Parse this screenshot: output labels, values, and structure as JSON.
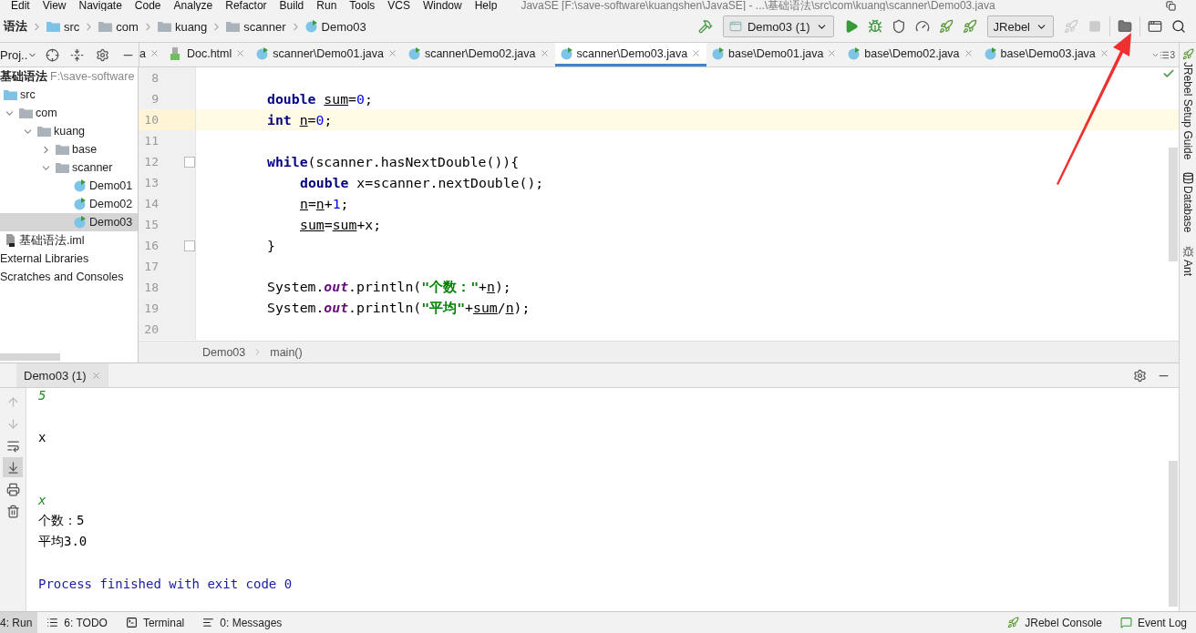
{
  "menu": {
    "items": [
      "Edit",
      "View",
      "Navigate",
      "Code",
      "Analyze",
      "Refactor",
      "Build",
      "Run",
      "Tools",
      "VCS",
      "Window",
      "Help"
    ],
    "title": "JavaSE [F:\\save-software\\kuangshen\\JavaSE] - ...\\基础语法\\src\\com\\kuang\\scanner\\Demo03.java"
  },
  "navbar": {
    "crumbs": [
      {
        "label": "语法",
        "kind": "project"
      },
      {
        "label": "src",
        "kind": "source"
      },
      {
        "label": "com",
        "kind": "folder"
      },
      {
        "label": "kuang",
        "kind": "folder"
      },
      {
        "label": "scanner",
        "kind": "folder"
      },
      {
        "label": "Demo03",
        "kind": "class"
      }
    ],
    "run_config": "Demo03 (1)",
    "jrebel_select": "JRebel"
  },
  "project_panel": {
    "title": "Proj..",
    "header": {
      "name": "基础语法",
      "path": "F:\\save-software"
    },
    "tree": [
      {
        "label": "src",
        "kind": "source",
        "selected": false
      },
      {
        "label": "com",
        "kind": "folder",
        "expanded": true,
        "selected": false,
        "children": [
          {
            "label": "kuang",
            "kind": "folder",
            "expanded": true,
            "selected": false,
            "children": [
              {
                "label": "base",
                "kind": "folder",
                "expanded": false,
                "selected": false
              },
              {
                "label": "scanner",
                "kind": "folder",
                "expanded": true,
                "selected": false,
                "children": [
                  {
                    "label": "Demo01",
                    "kind": "class",
                    "selected": false
                  },
                  {
                    "label": "Demo02",
                    "kind": "class",
                    "selected": false
                  },
                  {
                    "label": "Demo03",
                    "kind": "class",
                    "selected": true
                  }
                ]
              }
            ]
          }
        ]
      },
      {
        "label": "基础语法.iml",
        "kind": "file",
        "selected": false
      },
      {
        "label": "External Libraries",
        "kind": "plain",
        "selected": false
      },
      {
        "label": "Scratches and Consoles",
        "kind": "plain",
        "selected": false
      }
    ]
  },
  "editor_tabs": [
    {
      "label": "a",
      "kind": "cut",
      "selected": false
    },
    {
      "label": "Doc.html",
      "kind": "html",
      "selected": false
    },
    {
      "label": "scanner\\Demo01.java",
      "kind": "class",
      "selected": false
    },
    {
      "label": "scanner\\Demo02.java",
      "kind": "class",
      "selected": false
    },
    {
      "label": "scanner\\Demo03.java",
      "kind": "class",
      "selected": true
    },
    {
      "label": "base\\Demo01.java",
      "kind": "class",
      "selected": false
    },
    {
      "label": "base\\Demo02.java",
      "kind": "class",
      "selected": false
    },
    {
      "label": "base\\Demo03.java",
      "kind": "class",
      "selected": false
    }
  ],
  "tab_overflow": "3",
  "editor": {
    "lines": [
      {
        "number": "8",
        "highlighted": false,
        "fold": false
      },
      {
        "number": "9",
        "highlighted": false,
        "fold": false,
        "tokens": [
          {
            "text": "double",
            "kind": "type"
          },
          {
            "text": "sum",
            "kind": "var"
          },
          {
            "text": "=",
            "kind": "plain"
          },
          {
            "text": "0",
            "kind": "num"
          },
          {
            "text": ";",
            "kind": "plain"
          }
        ]
      },
      {
        "number": "10",
        "highlighted": true,
        "fold": false,
        "tokens": [
          {
            "text": "int",
            "kind": "type"
          },
          {
            "text": "n",
            "kind": "var"
          },
          {
            "text": "=",
            "kind": "plain"
          },
          {
            "text": "0",
            "kind": "num"
          },
          {
            "text": ";",
            "kind": "plain"
          }
        ]
      },
      {
        "number": "11",
        "highlighted": false,
        "fold": false
      },
      {
        "number": "12",
        "highlighted": false,
        "fold": true,
        "tokens": [
          {
            "text": "while",
            "kind": "kw"
          },
          {
            "text": "(scanner.hasNextDouble()){",
            "kind": "plain"
          }
        ],
        "children": [
          {
            "number": "13",
            "highlighted": false,
            "fold": false,
            "tokens": [
              {
                "text": "double",
                "kind": "type"
              },
              {
                "text": "x=scanner.nextDouble();",
                "kind": "plain"
              }
            ]
          },
          {
            "number": "14",
            "highlighted": false,
            "fold": false,
            "tokens": [
              {
                "text": "n",
                "kind": "var"
              },
              {
                "text": "=",
                "kind": "plain"
              },
              {
                "text": "n",
                "kind": "var"
              },
              {
                "text": "+",
                "kind": "plain"
              },
              {
                "text": "1",
                "kind": "num"
              },
              {
                "text": ";",
                "kind": "plain"
              }
            ]
          },
          {
            "number": "15",
            "highlighted": false,
            "fold": false,
            "tokens": [
              {
                "text": "sum",
                "kind": "var"
              },
              {
                "text": "=",
                "kind": "plain"
              },
              {
                "text": "sum",
                "kind": "var"
              },
              {
                "text": "+x;",
                "kind": "plain"
              }
            ]
          }
        ]
      },
      {
        "number": "16",
        "highlighted": false,
        "fold": true,
        "tokens": [
          {
            "text": "}",
            "kind": "plain"
          }
        ]
      },
      {
        "number": "17",
        "highlighted": false,
        "fold": false
      },
      {
        "number": "18",
        "highlighted": false,
        "fold": false,
        "tokens": [
          {
            "text": "System.",
            "kind": "plain"
          },
          {
            "text": "out",
            "kind": "field"
          },
          {
            "text": ".println(",
            "kind": "plain"
          },
          {
            "text": "\"个数：\"",
            "kind": "str"
          },
          {
            "text": "+",
            "kind": "plain"
          },
          {
            "text": "n",
            "kind": "var"
          },
          {
            "text": ");",
            "kind": "plain"
          }
        ]
      },
      {
        "number": "19",
        "highlighted": false,
        "fold": false,
        "tokens": [
          {
            "text": "System.",
            "kind": "plain"
          },
          {
            "text": "out",
            "kind": "field"
          },
          {
            "text": ".println(",
            "kind": "plain"
          },
          {
            "text": "\"平均\"",
            "kind": "str"
          },
          {
            "text": "+",
            "kind": "plain"
          },
          {
            "text": "sum",
            "kind": "var"
          },
          {
            "text": "/",
            "kind": "plain"
          },
          {
            "text": "n",
            "kind": "var"
          },
          {
            "text": ");",
            "kind": "plain"
          }
        ]
      },
      {
        "number": "20",
        "highlighted": false,
        "fold": false
      }
    ],
    "breadcrumb": [
      "Demo03",
      "main()"
    ]
  },
  "right_strip": [
    {
      "label": "JRebel Setup Guide",
      "kind": "rocket"
    },
    {
      "label": "Database",
      "kind": "database"
    },
    {
      "label": "Ant",
      "kind": "ant"
    }
  ],
  "run_panel": {
    "tab": "Demo03 (1)",
    "tools": [
      {
        "kind": "up",
        "selected": false,
        "disabled": true
      },
      {
        "kind": "down",
        "selected": false,
        "disabled": true
      },
      {
        "kind": "wrap",
        "selected": false,
        "disabled": false
      },
      {
        "kind": "scroll_end",
        "selected": true,
        "disabled": false
      },
      {
        "kind": "print",
        "selected": false,
        "disabled": false
      },
      {
        "kind": "trash",
        "selected": false,
        "disabled": false
      }
    ],
    "lines": [
      {
        "kind": "input",
        "text": "5"
      },
      {
        "kind": "blank"
      },
      {
        "kind": "output",
        "text": "x"
      },
      {
        "kind": "blank"
      },
      {
        "kind": "blank"
      },
      {
        "kind": "input",
        "text": "x"
      },
      {
        "kind": "output",
        "text": "个数：5"
      },
      {
        "kind": "output",
        "text": "平均3.0"
      },
      {
        "kind": "blank"
      },
      {
        "kind": "system",
        "text": "Process finished with exit code 0"
      }
    ]
  },
  "status_bar": {
    "left": [
      {
        "label": "4: Run",
        "kind": "none",
        "selected": true
      },
      {
        "label": "6: TODO",
        "kind": "list",
        "selected": false
      },
      {
        "label": "Terminal",
        "kind": "terminal",
        "selected": false
      },
      {
        "label": "0: Messages",
        "kind": "messages",
        "selected": false
      }
    ],
    "right": [
      {
        "label": "JRebel Console",
        "kind": "rocket"
      },
      {
        "label": "Event Log",
        "kind": "log"
      }
    ]
  }
}
